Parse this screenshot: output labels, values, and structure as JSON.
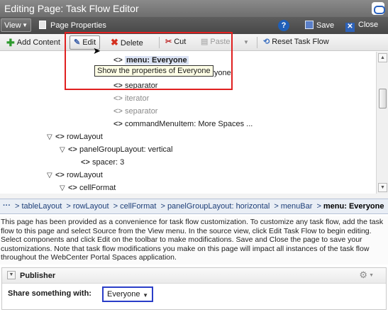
{
  "window": {
    "title": "Editing Page: Task Flow Editor"
  },
  "topbar": {
    "view_label": "View",
    "page_properties": "Page Properties",
    "help_label": "?",
    "save_label": "Save",
    "close_label": "Close"
  },
  "toolbar": {
    "add_content": "Add Content",
    "edit": "Edit",
    "delete": "Delete",
    "cut": "Cut",
    "paste": "Paste",
    "reset": "Reset Task Flow"
  },
  "tree": {
    "nodes": [
      {
        "label": "menu: Everyone",
        "state": "selected"
      },
      {
        "label": "commandMenuItem: Everyone",
        "state": "normal"
      },
      {
        "label": "separator",
        "state": "normal"
      },
      {
        "label": "iterator",
        "state": "disabled"
      },
      {
        "label": "separator",
        "state": "disabled"
      },
      {
        "label": "commandMenuItem: More Spaces ...",
        "state": "normal"
      },
      {
        "label": "rowLayout",
        "state": "normal"
      },
      {
        "label": "panelGroupLayout: vertical",
        "state": "normal"
      },
      {
        "label": "spacer: 3",
        "state": "normal"
      },
      {
        "label": "rowLayout",
        "state": "normal"
      },
      {
        "label": "cellFormat",
        "state": "normal"
      }
    ]
  },
  "tooltip": "Show the properties of Everyone",
  "breadcrumb": {
    "dots": "···",
    "items": [
      "tableLayout",
      "rowLayout",
      "cellFormat",
      "panelGroupLayout: horizontal",
      "menuBar"
    ],
    "current": "menu: Everyone"
  },
  "info_text": "This page has been provided as a convenience for task flow customization. To customize any task flow, add the task flow to this page and select Source from the View menu. In the source view, click Edit Task Flow to begin editing. Select components and click Edit on the toolbar to make modifications. Save and Close the page to save your customizations. Note that task flow modifications you make on this page will impact all instances of the task flow throughout the WebCenter Portal Spaces application.",
  "publisher": {
    "title": "Publisher",
    "share_label": "Share something with:",
    "share_value": "Everyone"
  },
  "colors": {
    "highlight": "#e02020",
    "selection": "#2a3ec8",
    "link": "#1d3e78"
  }
}
